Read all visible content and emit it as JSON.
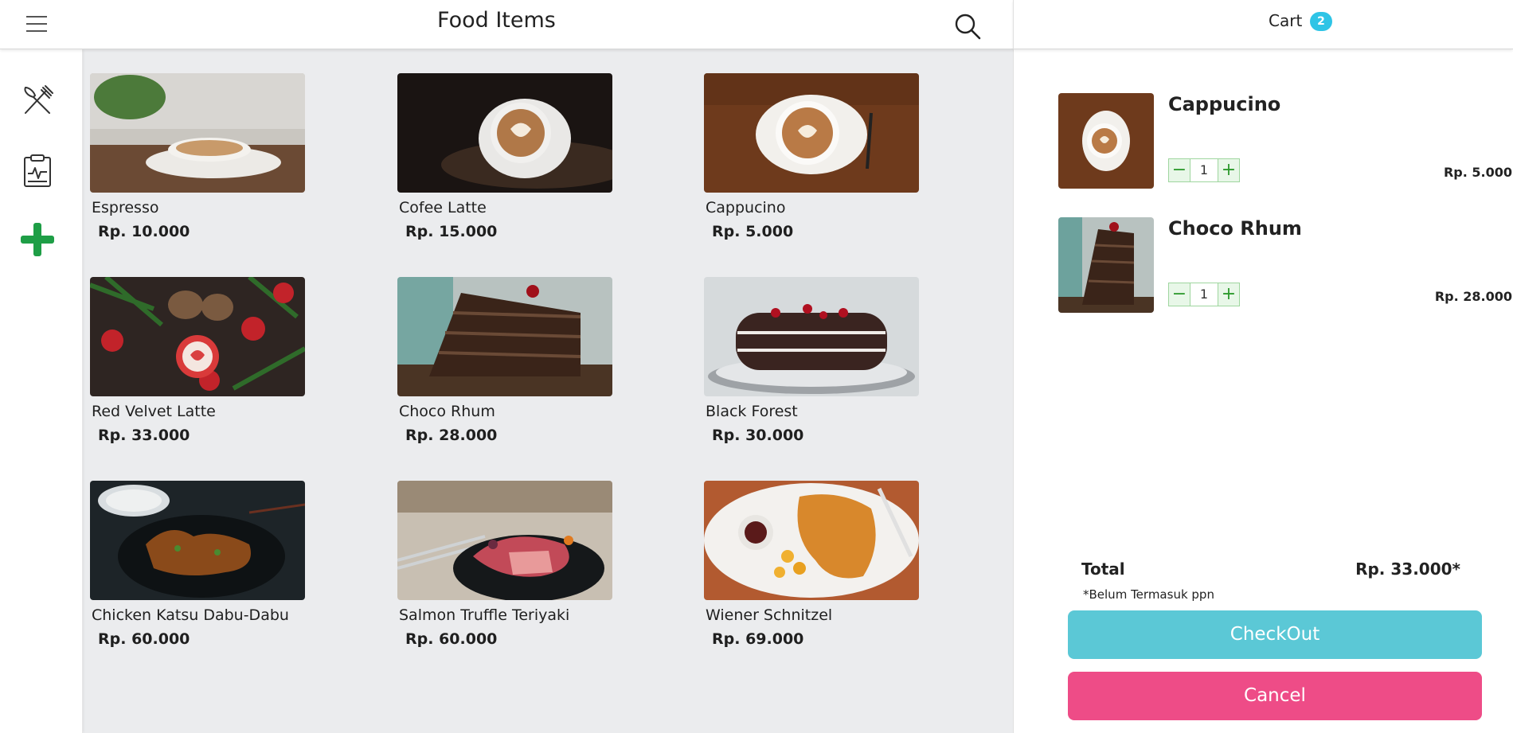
{
  "header": {
    "title": "Food Items"
  },
  "cart_header": {
    "title": "Cart",
    "count": "2"
  },
  "colors": {
    "accent": "#2ec4e6",
    "checkout": "#5bc8d6",
    "cancel": "#ee4c87",
    "add": "#1e9e46"
  },
  "sidebar": {
    "items": [
      {
        "icon": "utensils-icon"
      },
      {
        "icon": "clipboard-icon"
      },
      {
        "icon": "plus-icon"
      }
    ]
  },
  "foods": [
    {
      "name": "Espresso",
      "price": "Rp. 10.000"
    },
    {
      "name": "Cofee Latte",
      "price": "Rp. 15.000"
    },
    {
      "name": "Cappucino",
      "price": "Rp. 5.000"
    },
    {
      "name": "Red Velvet Latte",
      "price": "Rp. 33.000"
    },
    {
      "name": "Choco Rhum",
      "price": "Rp. 28.000"
    },
    {
      "name": "Black Forest",
      "price": "Rp. 30.000"
    },
    {
      "name": "Chicken Katsu Dabu-Dabu",
      "price": "Rp. 60.000"
    },
    {
      "name": "Salmon Truffle Teriyaki",
      "price": "Rp. 60.000"
    },
    {
      "name": "Wiener Schnitzel",
      "price": "Rp. 69.000"
    }
  ],
  "cart": {
    "items": [
      {
        "name": "Cappucino",
        "qty": "1",
        "price": "Rp. 5.000",
        "minus": "−",
        "plus": "+"
      },
      {
        "name": "Choco Rhum",
        "qty": "1",
        "price": "Rp. 28.000",
        "minus": "−",
        "plus": "+"
      }
    ],
    "total_label": "Total",
    "total_value": "Rp. 33.000*",
    "note": "*Belum Termasuk ppn",
    "checkout_label": "CheckOut",
    "cancel_label": "Cancel"
  }
}
